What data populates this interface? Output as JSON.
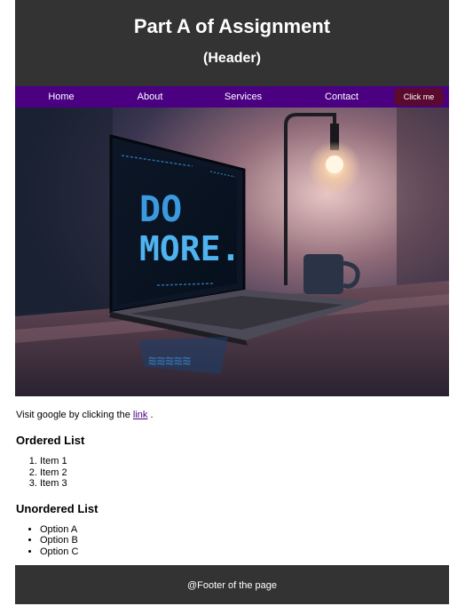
{
  "header": {
    "title": "Part A of Assignment",
    "subtitle": "(Header)"
  },
  "nav": {
    "items": [
      {
        "label": "Home"
      },
      {
        "label": "About"
      },
      {
        "label": "Services"
      },
      {
        "label": "Contact"
      }
    ],
    "button_label": "Click me"
  },
  "hero": {
    "screen_text_line1": "DO",
    "screen_text_line2": "MORE."
  },
  "main": {
    "visit_prefix": "Visit google by clicking the",
    "link_label": "link",
    "visit_suffix": ".",
    "ordered_heading": "Ordered List",
    "ordered_items": [
      "Item 1",
      "Item 2",
      "Item 3"
    ],
    "unordered_heading": "Unordered List",
    "unordered_items": [
      "Option A",
      "Option B",
      "Option C"
    ]
  },
  "footer": {
    "text": "@Footer of the page"
  },
  "colors": {
    "header_bg": "#333333",
    "nav_bg": "#4b0082",
    "button_bg": "#5a0a2e",
    "link": "#4b0082"
  }
}
